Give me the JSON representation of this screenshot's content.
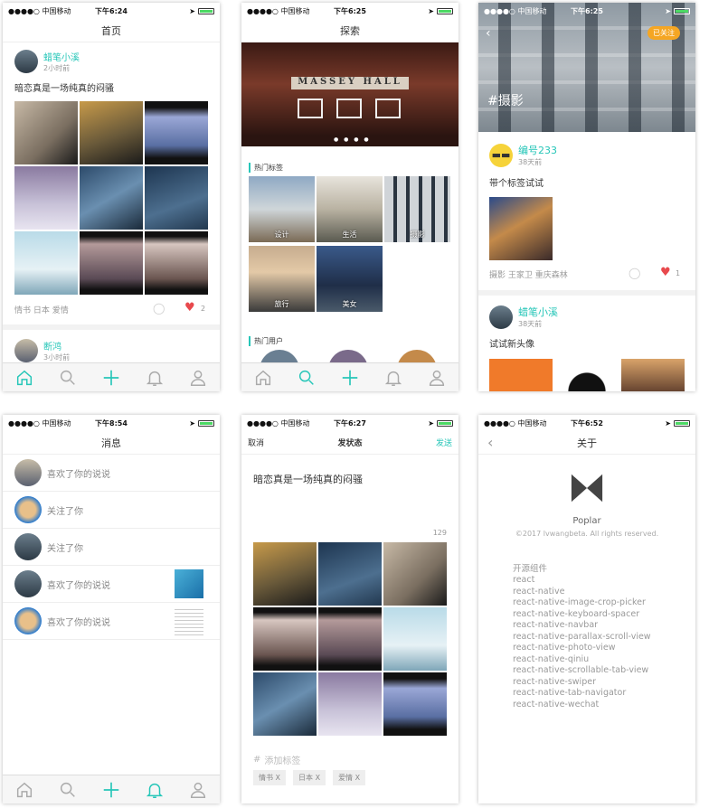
{
  "status_bars": [
    {
      "carrier": "●●●●○ 中国移动",
      "time": "下午6:24"
    },
    {
      "carrier": "●●●●○ 中国移动",
      "time": "下午6:25"
    },
    {
      "carrier": "●●●●○ 中国移动",
      "time": "下午6:25"
    },
    {
      "carrier": "●●●●○ 中国移动",
      "time": "下午8:54"
    },
    {
      "carrier": "●●●●○ 中国移动",
      "time": "下午6:27"
    },
    {
      "carrier": "●●●●○ 中国移动",
      "time": "下午6:52"
    }
  ],
  "home": {
    "title": "首页",
    "post": {
      "author": "蜡笔小溪",
      "time": "2小时前",
      "text": "暗恋真是一场纯真的闷骚",
      "tags": "情书  日本  爱情",
      "likes": "2"
    },
    "next": {
      "author": "断鸿",
      "time": "3小时前"
    }
  },
  "explore": {
    "title": "探索",
    "banner_text": "MASSEY HALL",
    "hot_tags_title": "热门标签",
    "tags": [
      "设计",
      "生活",
      "摄影",
      "旅行",
      "美女"
    ],
    "hot_users_title": "热门用户"
  },
  "tag_page": {
    "tag": "#摄影",
    "follow_label": "已关注",
    "post1": {
      "author": "编号233",
      "time": "38天前",
      "text": "带个标签试试",
      "tags": "摄影  王家卫  重庆森林",
      "likes": "1"
    },
    "post2": {
      "author": "蜡笔小溪",
      "time": "38天前",
      "text": "试试新头像"
    }
  },
  "messages": {
    "title": "消息",
    "items": [
      "喜欢了你的说说",
      "关注了你",
      "关注了你",
      "喜欢了你的说说",
      "喜欢了你的说说"
    ]
  },
  "compose": {
    "cancel": "取消",
    "title": "发状态",
    "send": "发送",
    "text": "暗恋真是一场纯真的闷骚",
    "count": "129",
    "add_tag": "添加标签",
    "tags": [
      "情书 X",
      "日本 X",
      "爱情 X"
    ]
  },
  "about": {
    "title": "关于",
    "app_name": "Poplar",
    "copyright": "©2017 lvwangbeta. All rights reserved.",
    "oss_title": "开源组件",
    "libs": [
      "react",
      "react-native",
      "react-native-image-crop-picker",
      "react-native-keyboard-spacer",
      "react-native-navbar",
      "react-native-parallax-scroll-view",
      "react-native-photo-view",
      "react-native-qiniu",
      "react-native-scrollable-tab-view",
      "react-native-swiper",
      "react-native-tab-navigator",
      "react-native-wechat"
    ]
  },
  "colors": {
    "accent": "#26c6b8",
    "like": "#e8494d",
    "follow": "#f5a623"
  }
}
